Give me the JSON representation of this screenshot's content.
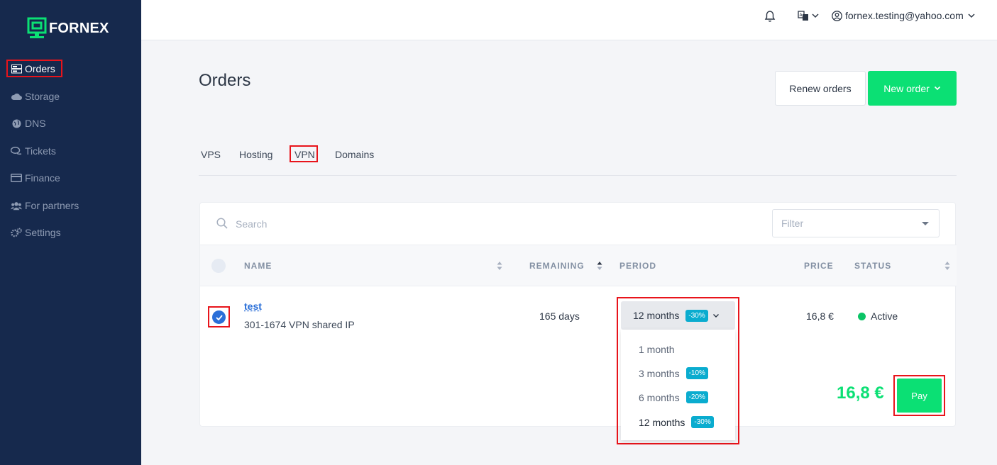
{
  "brand": {
    "name": "FORNEX",
    "accent": "#0be074",
    "sidebar_bg": "#16294d"
  },
  "sidebar": {
    "items": [
      {
        "label": "Orders",
        "icon": "server-icon",
        "active": true
      },
      {
        "label": "Storage",
        "icon": "cloud-icon"
      },
      {
        "label": "DNS",
        "icon": "globe-icon"
      },
      {
        "label": "Tickets",
        "icon": "chat-icon"
      },
      {
        "label": "Finance",
        "icon": "credit-card-icon"
      },
      {
        "label": "For partners",
        "icon": "users-icon"
      },
      {
        "label": "Settings",
        "icon": "gears-icon"
      }
    ]
  },
  "header": {
    "user_email": "fornex.testing@yahoo.com"
  },
  "page": {
    "title": "Orders",
    "renew_label": "Renew orders",
    "new_order_label": "New order"
  },
  "tabs": [
    {
      "label": "VPS"
    },
    {
      "label": "Hosting"
    },
    {
      "label": "VPN",
      "active": true
    },
    {
      "label": "Domains"
    }
  ],
  "search": {
    "placeholder": "Search"
  },
  "filter": {
    "placeholder": "Filter"
  },
  "table": {
    "columns": [
      "NAME",
      "REMAINING",
      "PERIOD",
      "PRICE",
      "STATUS"
    ],
    "rows": [
      {
        "name": "test",
        "subtitle": "301-1674  VPN shared IP",
        "remaining": "165 days",
        "period": "12 months",
        "period_discount": "-30%",
        "price": "16,8 €",
        "status": "Active",
        "checked": true
      }
    ]
  },
  "period_options": [
    {
      "label": "1 month",
      "discount": ""
    },
    {
      "label": "3 months",
      "discount": "-10%"
    },
    {
      "label": "6 months",
      "discount": "-20%"
    },
    {
      "label": "12 months",
      "discount": "-30%",
      "selected": true
    }
  ],
  "total": "16,8 €",
  "pay_label": "Pay"
}
